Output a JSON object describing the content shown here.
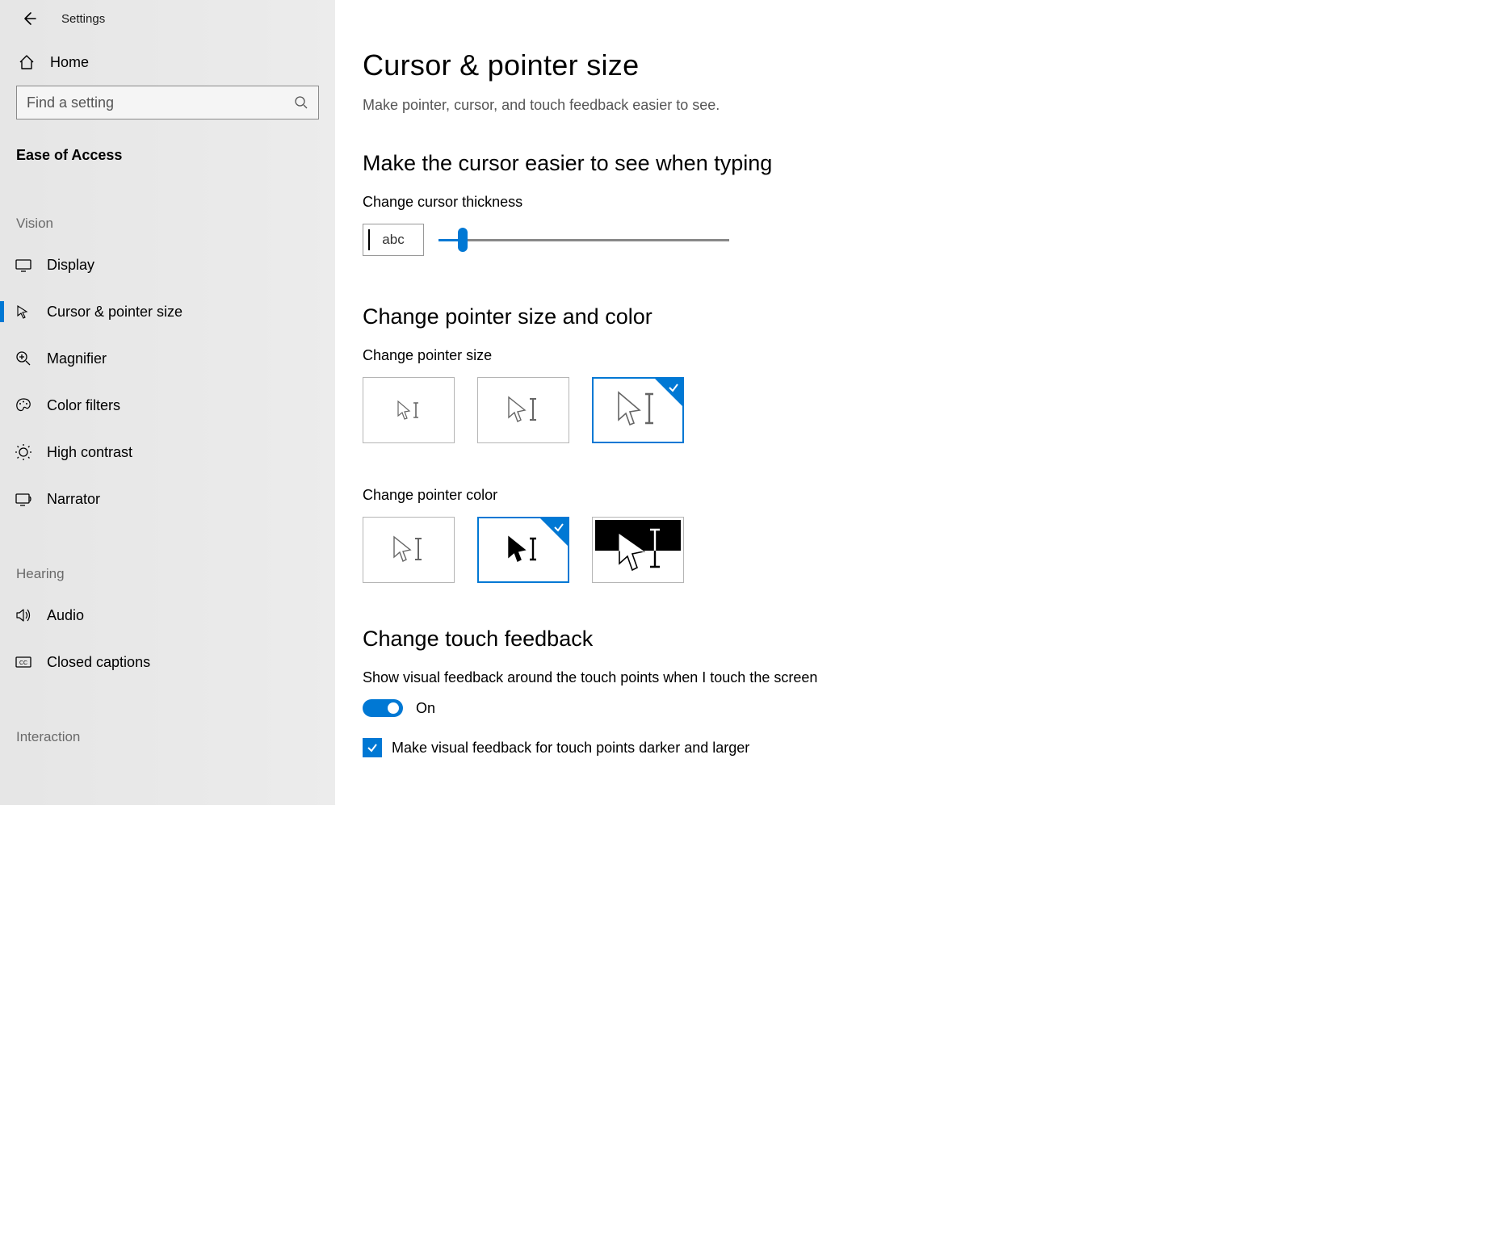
{
  "appTitle": "Settings",
  "home": "Home",
  "searchPlaceholder": "Find a setting",
  "categoryTitle": "Ease of Access",
  "groups": {
    "vision": "Vision",
    "hearing": "Hearing",
    "interaction": "Interaction"
  },
  "nav": {
    "display": "Display",
    "cursor": "Cursor & pointer size",
    "magnifier": "Magnifier",
    "colorFilters": "Color filters",
    "highContrast": "High contrast",
    "narrator": "Narrator",
    "audio": "Audio",
    "closedCaptions": "Closed captions"
  },
  "page": {
    "title": "Cursor & pointer size",
    "description": "Make pointer, cursor, and touch feedback easier to see."
  },
  "cursorSection": {
    "heading": "Make the cursor easier to see when typing",
    "label": "Change cursor thickness",
    "preview": "abc"
  },
  "pointerSection": {
    "heading": "Change pointer size and color",
    "sizeLabel": "Change pointer size",
    "colorLabel": "Change pointer color"
  },
  "touchSection": {
    "heading": "Change touch feedback",
    "toggleHelp": "Show visual feedback around the touch points when I touch the screen",
    "toggleState": "On",
    "checkboxLabel": "Make visual feedback for touch points darker and larger"
  }
}
